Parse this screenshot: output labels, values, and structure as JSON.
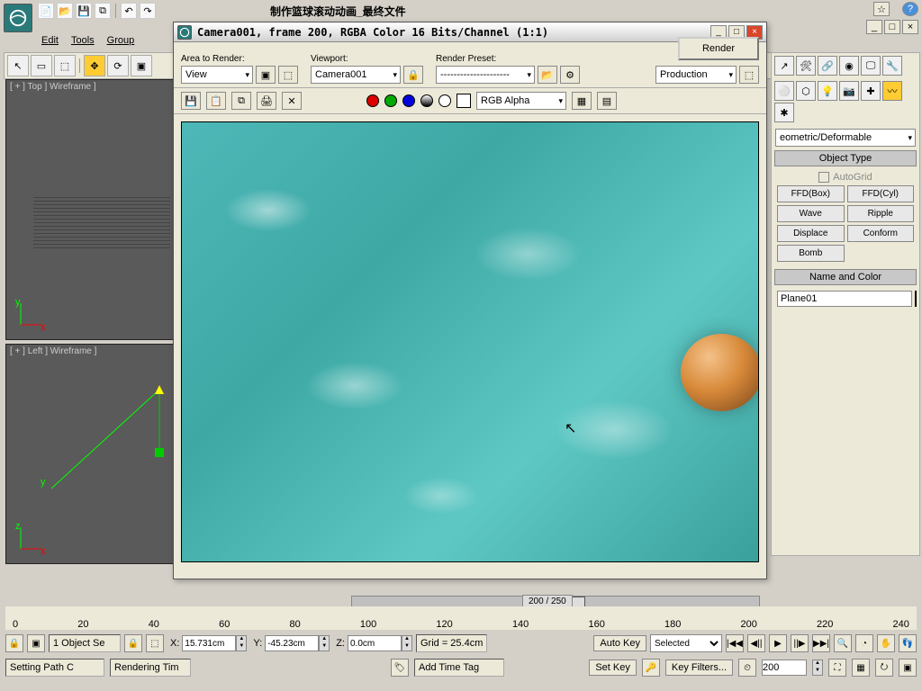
{
  "app": {
    "doc_title": "制作篮球滚动动画_最终文件"
  },
  "menu": {
    "edit": "Edit",
    "tools": "Tools",
    "group": "Group"
  },
  "main_win": {
    "min": "_",
    "max": "□",
    "close": "×"
  },
  "render_dialog": {
    "title": "Camera001, frame 200, RGBA Color 16 Bits/Channel (1:1)",
    "area_label": "Area to Render:",
    "area_value": "View",
    "viewport_label": "Viewport:",
    "viewport_value": "Camera001",
    "preset_label": "Render Preset:",
    "preset_value": "---------------------",
    "render_btn": "Render",
    "production": "Production",
    "channel": "RGB Alpha"
  },
  "viewports": {
    "top": "[ + ] Top ] Wireframe ]",
    "left": "[ + ] Left ] Wireframe ]"
  },
  "side": {
    "dropdown": "eometric/Deformable",
    "obj_type": "Object Type",
    "autogrid": "AutoGrid",
    "btns": {
      "ffd_box": "FFD(Box)",
      "ffd_cyl": "FFD(Cyl)",
      "wave": "Wave",
      "ripple": "Ripple",
      "displace": "Displace",
      "conform": "Conform",
      "bomb": "Bomb"
    },
    "name_color": "Name and Color",
    "object_name": "Plane01"
  },
  "timeline": {
    "frame_display": "200 / 250",
    "ticks": [
      "0",
      "20",
      "40",
      "60",
      "80",
      "100",
      "120",
      "140",
      "160",
      "180",
      "200",
      "220",
      "240"
    ]
  },
  "status": {
    "sel": "1 Object Se",
    "x_label": "X:",
    "x": "15.731cm",
    "y_label": "Y:",
    "y": "-45.23cm",
    "z_label": "Z:",
    "z": "0.0cm",
    "grid": "Grid = 25.4cm",
    "autokey": "Auto Key",
    "selected": "Selected",
    "setkey": "Set Key",
    "keyfilters": "Key Filters...",
    "frame": "200",
    "path": "Setting Path C",
    "render_time": "Rendering Tim",
    "addtag": "Add Time Tag"
  }
}
